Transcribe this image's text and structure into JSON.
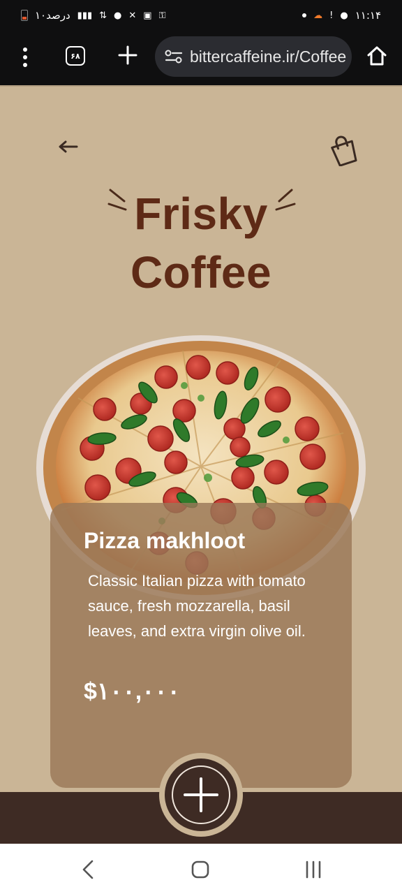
{
  "status_bar": {
    "time": "۱۱:۱۴",
    "battery_label": "۱۰درصد",
    "icons": [
      "battery-low-icon",
      "signal-icon",
      "data-arrows-icon",
      "location-icon",
      "mute-icon",
      "clipboard-icon",
      "key-icon",
      "dot-icon",
      "cloud-icon",
      "alert-icon",
      "chat-icon"
    ]
  },
  "browser": {
    "tab_count": "۶۸",
    "url": "bittercaffeine.ir/Coffee",
    "icons": [
      "menu-dots-icon",
      "tabs-icon",
      "plus-icon",
      "tune-icon",
      "home-icon"
    ]
  },
  "page": {
    "title_line1": "Frisky",
    "title_line2": "Coffee",
    "back_icon": "arrow-left-icon",
    "bag_icon": "shopping-bag-icon"
  },
  "product": {
    "name": "Pizza makhloot",
    "description": "Classic Italian pizza with tomato sauce, fresh mozzarella, basil leaves, and extra virgin olive oil.",
    "price": "$۱۰۰,۰۰۰",
    "image": "pepperoni-jalapeno-pizza"
  },
  "actions": {
    "add_icon": "plus-icon"
  },
  "system_nav": {
    "icons": [
      "nav-back-icon",
      "nav-home-icon",
      "nav-recents-icon"
    ]
  },
  "colors": {
    "page_bg": "#cab596",
    "title": "#5e2a16",
    "card": "#9a7758",
    "bottom_bar": "#3e2b24",
    "toolbar": "#0f0f10"
  }
}
